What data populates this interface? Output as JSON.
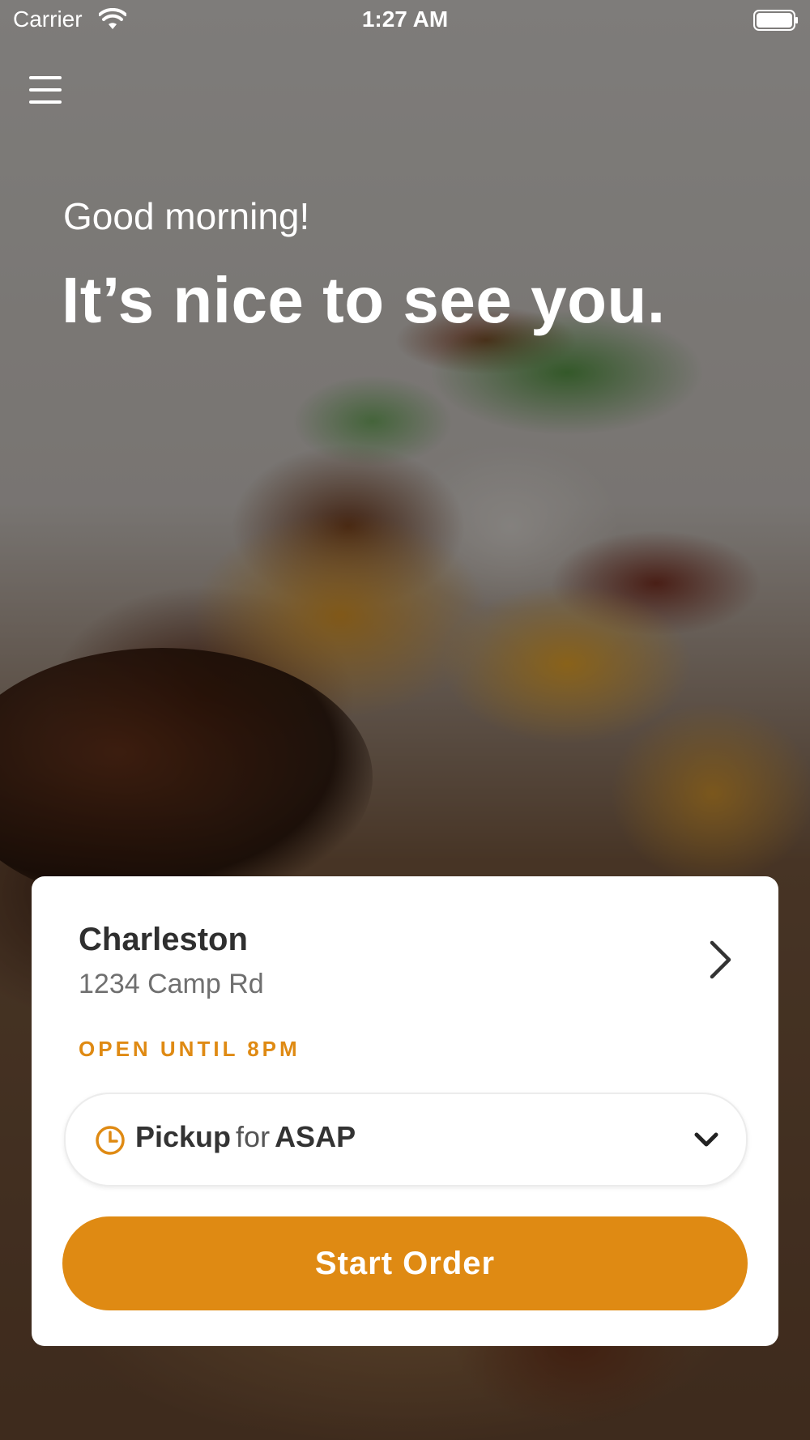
{
  "status_bar": {
    "carrier": "Carrier",
    "time": "1:27 AM",
    "wifi_icon": "wifi-icon",
    "battery_icon": "battery-icon"
  },
  "header": {
    "menu_icon": "hamburger-menu-icon"
  },
  "hero": {
    "greeting": "Good morning!",
    "headline": "It’s nice to see you."
  },
  "location_card": {
    "name": "Charleston",
    "address": "1234 Camp Rd",
    "hours": "OPEN UNTIL 8PM",
    "chevron_icon": "chevron-right-icon"
  },
  "order_type": {
    "mode": "Pickup",
    "connector": "for",
    "time": "ASAP",
    "clock_icon": "clock-icon",
    "dropdown_icon": "chevron-down-icon"
  },
  "cta": {
    "label": "Start Order"
  },
  "colors": {
    "accent": "#df8a13",
    "card_bg": "#ffffff",
    "text_primary": "#2f2f2f",
    "text_secondary": "#6f6f6f"
  }
}
